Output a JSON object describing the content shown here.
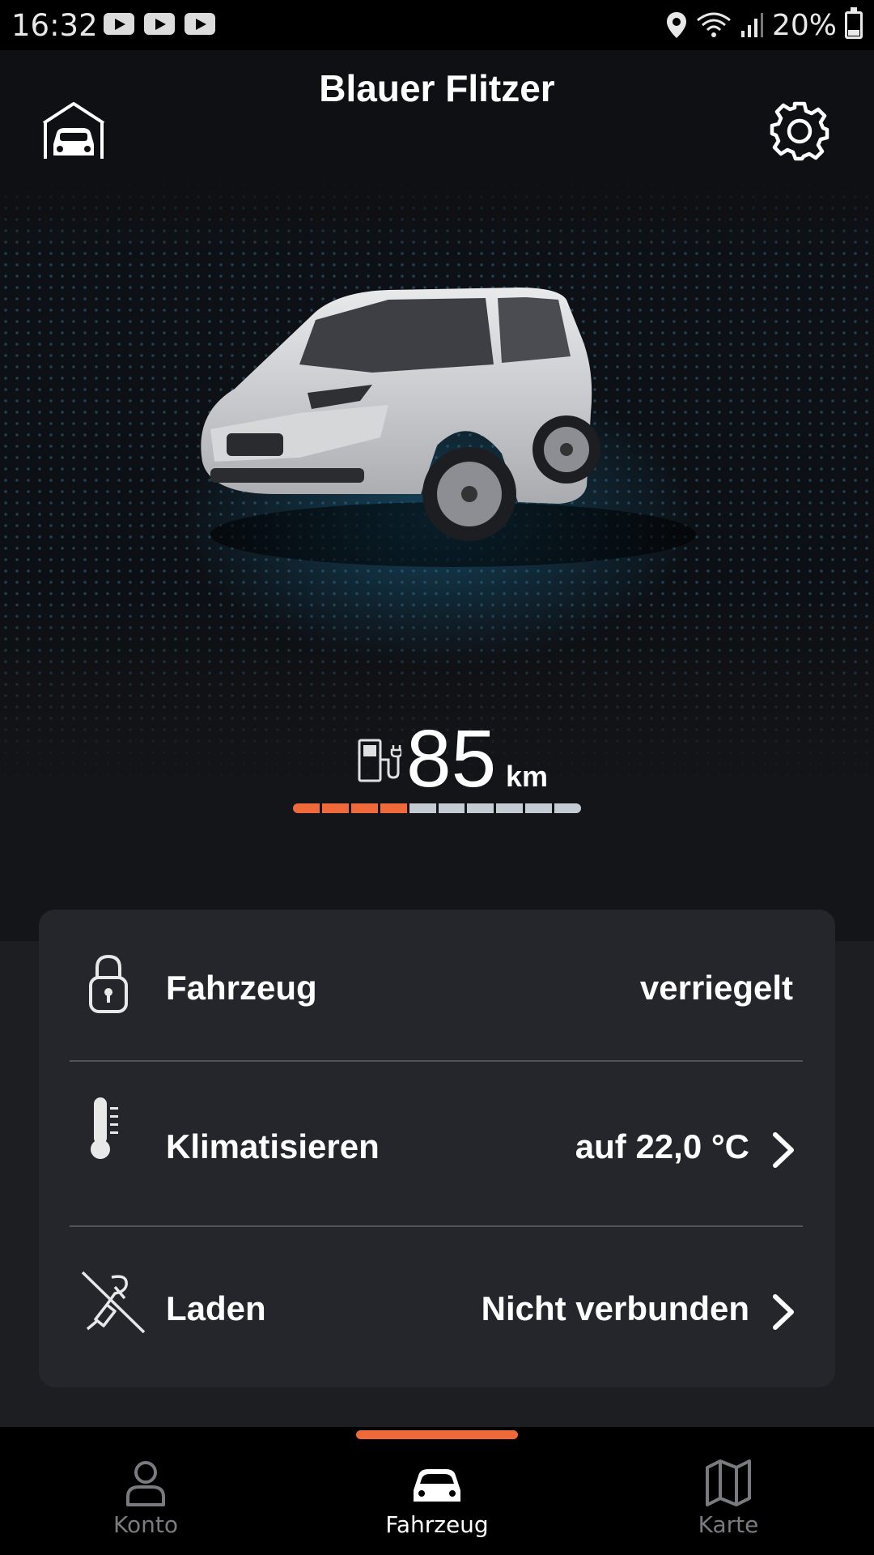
{
  "status_bar": {
    "time": "16:32",
    "notifications": [
      "youtube-icon",
      "youtube-icon",
      "youtube-icon"
    ],
    "icons": [
      "location-icon",
      "wifi-icon",
      "signal-icon"
    ],
    "battery_percent": "20%"
  },
  "header": {
    "title": "Blauer Flitzer",
    "left_icon": "garage-icon",
    "right_icon": "settings-icon"
  },
  "vehicle": {
    "image": "car-image"
  },
  "range": {
    "value": "85",
    "unit": "km",
    "icon": "fuel-charge-icon",
    "segments_total": 10,
    "segments_filled": 4,
    "fill_color": "#ee6a3a",
    "empty_color": "#c4cbd2"
  },
  "status_card": {
    "rows": [
      {
        "icon": "lock-icon",
        "label": "Fahrzeug",
        "value": "verriegelt"
      },
      {
        "icon": "thermometer-icon",
        "label": "Klimatisieren",
        "value": "auf 22,0 °C"
      },
      {
        "icon": "charging-off-icon",
        "label": "Laden",
        "value": "Nicht verbunden"
      }
    ]
  },
  "bottom_nav": {
    "items": [
      {
        "label": "Konto",
        "icon": "person-icon"
      },
      {
        "label": "Fahrzeug",
        "icon": "car-icon"
      },
      {
        "label": "Karte",
        "icon": "map-icon"
      }
    ],
    "active": "Fahrzeug",
    "accent_color": "#ee6a3a"
  }
}
